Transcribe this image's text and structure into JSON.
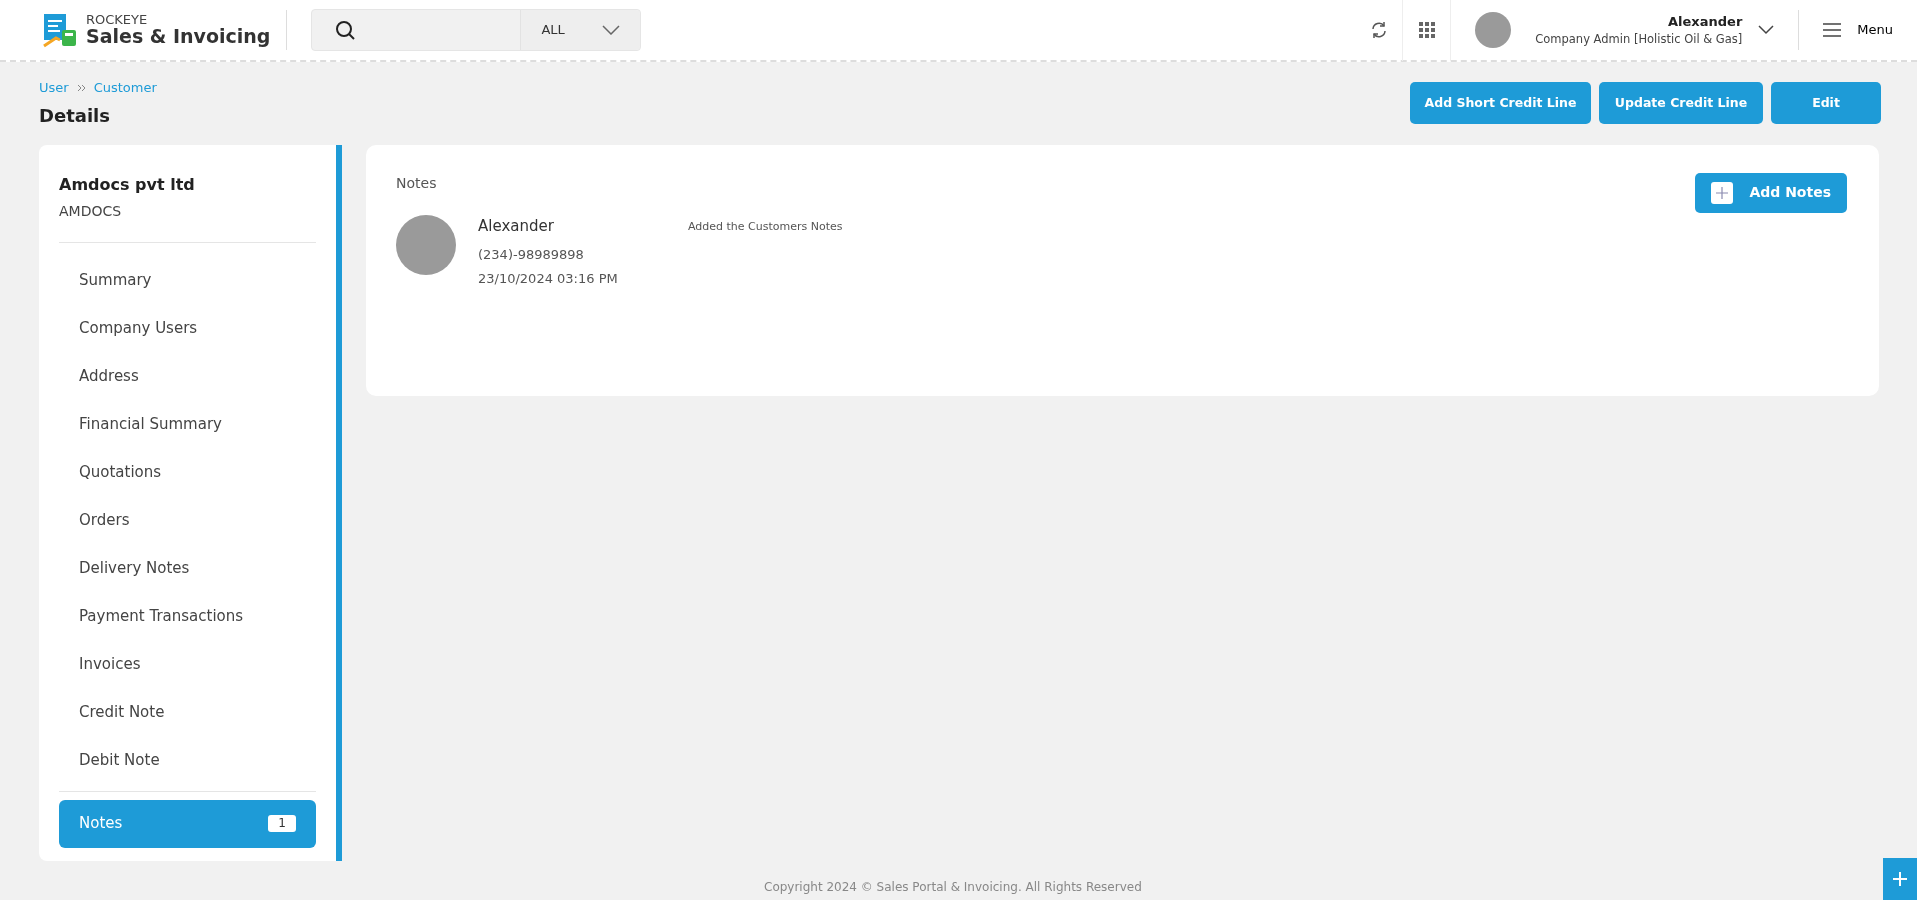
{
  "header": {
    "brand_top": "ROCKEYE",
    "brand": "Sales & Invoicing",
    "search": {
      "scope": "ALL"
    },
    "user": {
      "name": "Alexander",
      "role": "Company Admin [Holistic Oil & Gas]"
    },
    "menu_label": "Menu"
  },
  "breadcrumb": [
    "User",
    "Customer"
  ],
  "page_title": "Details",
  "actions": [
    "Add Short Credit Line",
    "Update Credit Line",
    "Edit"
  ],
  "customer": {
    "name": "Amdocs pvt ltd",
    "code": "AMDOCS"
  },
  "sidebar": {
    "items": [
      {
        "label": "Summary",
        "selected": false
      },
      {
        "label": "Company Users",
        "selected": false
      },
      {
        "label": "Address",
        "selected": false
      },
      {
        "label": "Financial Summary",
        "selected": false
      },
      {
        "label": "Quotations",
        "selected": false
      },
      {
        "label": "Orders",
        "selected": false
      },
      {
        "label": "Delivery Notes",
        "selected": false
      },
      {
        "label": "Payment Transactions",
        "selected": false
      },
      {
        "label": "Invoices",
        "selected": false
      },
      {
        "label": "Credit Note",
        "selected": false
      },
      {
        "label": "Debit Note",
        "selected": false
      },
      {
        "label": "Notes",
        "selected": true,
        "badge": "1"
      }
    ]
  },
  "notes": {
    "title": "Notes",
    "add_button": "Add Notes",
    "entries": [
      {
        "author": "Alexander",
        "phone": "(234)-98989898",
        "date": "23/10/2024 03:16 PM",
        "text": "Added the Customers Notes"
      }
    ]
  },
  "footer": "Copyright 2024 © Sales Portal & Invoicing. All Rights Reserved"
}
